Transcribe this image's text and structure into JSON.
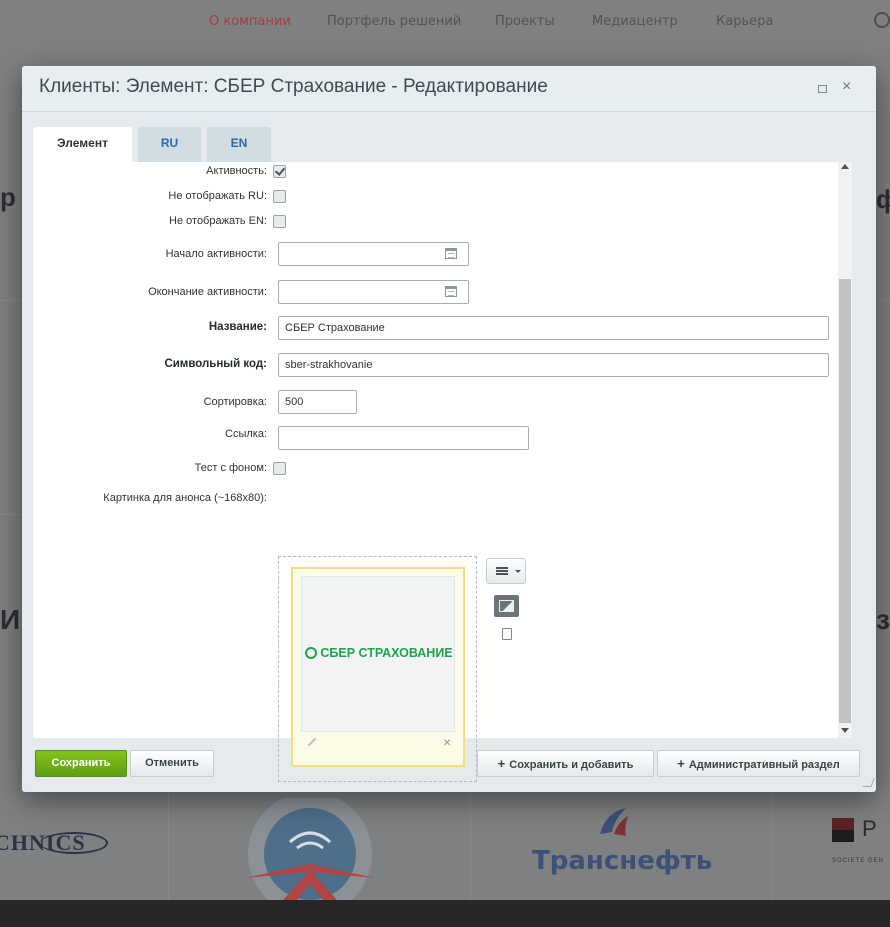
{
  "site": {
    "nav": [
      "О компании",
      "Портфель решений",
      "Проекты",
      "Медиацентр",
      "Карьера"
    ],
    "logos": {
      "technics": "CHNICS",
      "transneft": "Транснефть",
      "socgen": "P",
      "socgen_sub": "SOCIETE GEN"
    }
  },
  "dialog": {
    "title": "Клиенты: Элемент: СБЕР Страхование - Редактирование",
    "tabs": [
      "Элемент",
      "RU",
      "EN"
    ],
    "fields": {
      "active_label": "Активность:",
      "hide_ru_label": "Не отображать RU:",
      "hide_en_label": "Не отображать EN:",
      "active_from_label": "Начало активности:",
      "active_to_label": "Окончание активности:",
      "name_label": "Название:",
      "name_value": "СБЕР Страхование",
      "code_label": "Символьный код:",
      "code_value": "sber-strakhovanie",
      "sort_label": "Сортировка:",
      "sort_value": "500",
      "link_label": "Ссылка:",
      "link_value": "",
      "bg_test_label": "Тест с фоном:",
      "preview_label": "Картинка для анонса (~168x80):",
      "preview_logo_text": "СБЕР СТРАХОВАНИЕ"
    },
    "checkboxes": {
      "active": true,
      "hide_ru": false,
      "hide_en": false,
      "bg_test": false
    },
    "buttons": {
      "save": "Сохранить",
      "cancel": "Отменить",
      "save_add": "Сохранить и добавить",
      "admin": "Административный раздел"
    }
  },
  "colors": {
    "save_green": "#6aad17",
    "tab_link": "#2e67a8",
    "sber_green": "#1fa34a"
  }
}
